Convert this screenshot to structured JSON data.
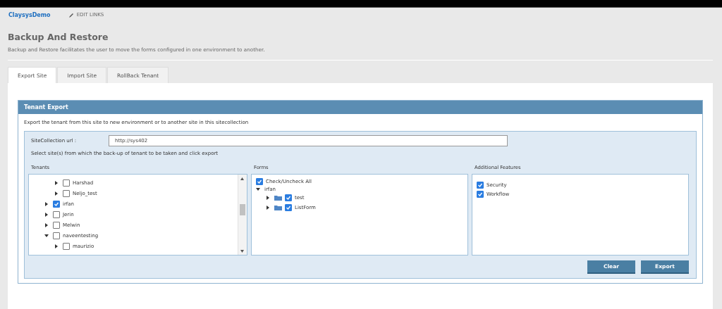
{
  "top_bar": {
    "site_name": "ClaysysDemo",
    "edit_links": "EDIT LINKS"
  },
  "page": {
    "title": "Backup And Restore",
    "description": "Backup and Restore facilitates the user to move the forms configured in one environment to another."
  },
  "tabs": [
    {
      "label": "Export Site",
      "selected": true
    },
    {
      "label": "Import Site",
      "selected": false
    },
    {
      "label": "RollBack Tenant",
      "selected": false
    }
  ],
  "panel": {
    "title": "Tenant Export",
    "intro": "Export the tenant from this site to new environment or to another site in this sitecollection",
    "url_label": "SiteCollection url :",
    "url_value": "http://sys402",
    "instruction": "Select site(s) from which the back-up of tenant to be taken and click export",
    "tenants": {
      "heading": "Tenants",
      "items": [
        {
          "children": [
            {
              "label": "Harshad",
              "checked": false,
              "expanded": false
            },
            {
              "label": "Neljo_test",
              "checked": false,
              "expanded": false
            }
          ]
        },
        {
          "label": "irfan",
          "checked": true,
          "expanded": false
        },
        {
          "label": "Jerin",
          "checked": false,
          "expanded": false
        },
        {
          "label": "Melwin",
          "checked": false,
          "expanded": false
        },
        {
          "label": "naveentesting",
          "checked": false,
          "expanded": true,
          "children": [
            {
              "label": "maurizio",
              "checked": false,
              "expanded": false
            }
          ]
        }
      ]
    },
    "forms": {
      "heading": "Forms",
      "check_all": {
        "label": "Check/Uncheck All",
        "checked": true
      },
      "groups": [
        {
          "label": "irfan",
          "expanded": true,
          "children": [
            {
              "label": "test",
              "checked": true,
              "expanded": false
            },
            {
              "label": "ListForm",
              "checked": true,
              "expanded": false
            }
          ]
        }
      ]
    },
    "features": {
      "heading": "Additional Features",
      "items": [
        {
          "label": "Security",
          "checked": true
        },
        {
          "label": "Workflow",
          "checked": true
        }
      ]
    },
    "buttons": [
      "Clear",
      "Export"
    ]
  }
}
